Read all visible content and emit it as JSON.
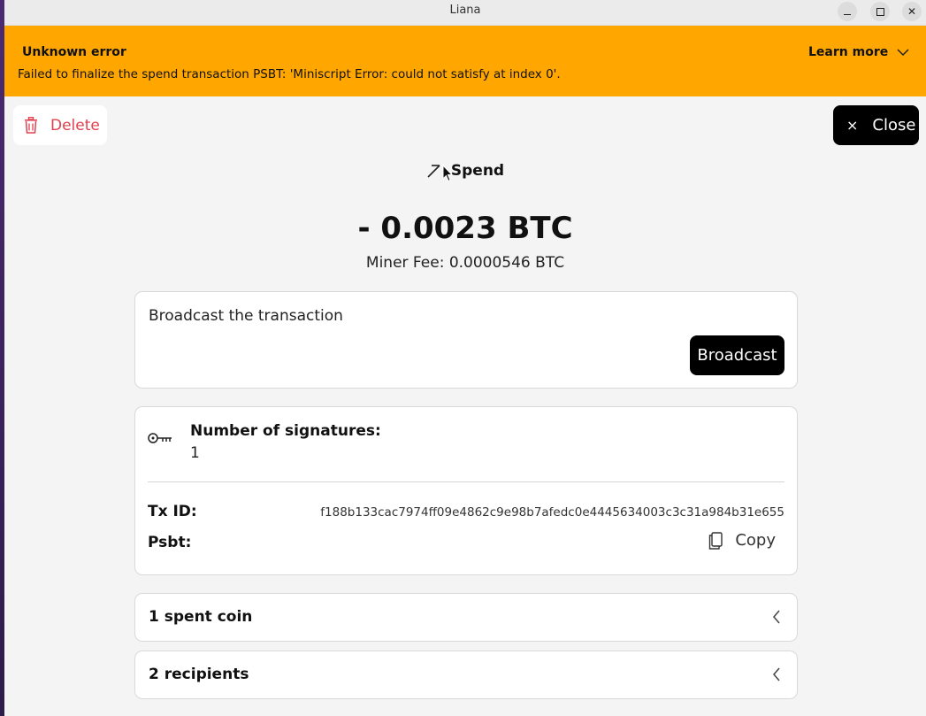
{
  "window": {
    "title": "Liana",
    "minimize_label": "_",
    "close_symbol": "✕"
  },
  "banner": {
    "heading": "Unknown error",
    "message": "Failed to finalize the spend transaction PSBT: 'Miniscript Error: could not satisfy at index 0'.",
    "learn_more": "Learn more",
    "color": "#ffa700"
  },
  "actions": {
    "delete_label": "Delete",
    "close_label": "Close",
    "close_symbol": "×"
  },
  "spend": {
    "title": "Spend",
    "amount": "- 0.0023 BTC",
    "miner_fee": "Miner Fee: 0.0000546 BTC"
  },
  "broadcast": {
    "label": "Broadcast the transaction",
    "button_label": "Broadcast"
  },
  "signatures": {
    "title": "Number of signatures:",
    "count": "1",
    "icon": "key-icon"
  },
  "transaction": {
    "txid_label": "Tx ID:",
    "txid_value": "f188b133cac7974ff09e4862c9e98b7afedc0e4445634003c3c31a984b31e655",
    "psbt_label": "Psbt:",
    "copy_label": "Copy"
  },
  "sections": {
    "coins_label": "1 spent coin",
    "recipients_label": "2 recipients"
  }
}
